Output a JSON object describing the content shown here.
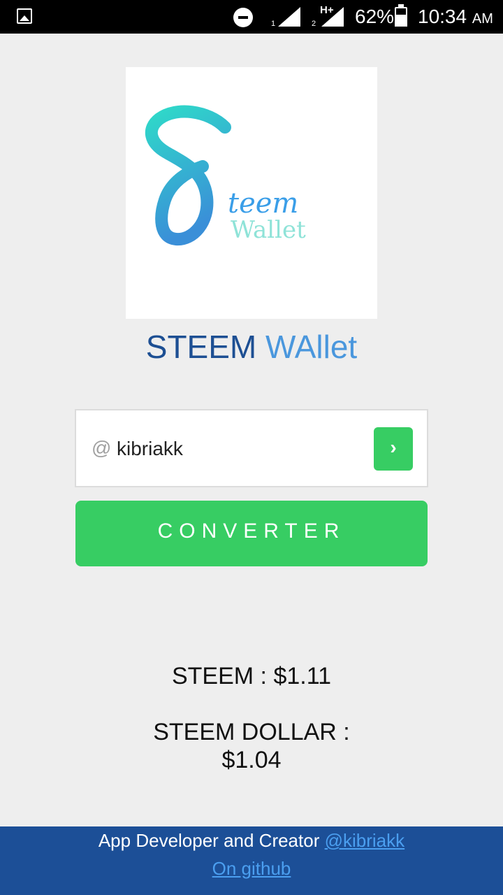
{
  "status_bar": {
    "sim1_label": "1",
    "sim2_label": "2",
    "network_type": "H+",
    "battery_percent": "62%",
    "battery_level": 0.62,
    "time": "10:34",
    "ampm": "AM",
    "icons": [
      "gallery-icon",
      "do-not-disturb-icon",
      "signal-icon",
      "battery-icon"
    ]
  },
  "logo": {
    "text_top": "teem",
    "text_bottom": "Wallet"
  },
  "title": {
    "part1": "STEEM",
    "part2": "WAllet"
  },
  "username": {
    "prefix": "@",
    "value": "kibriakk",
    "go_icon": "chevron-right-icon",
    "go_symbol": "›"
  },
  "converter_button": "CONVERTER",
  "prices": {
    "steem": "STEEM : $1.11",
    "sbd_label": "STEEM DOLLAR :",
    "sbd_value": "$1.04"
  },
  "footer": {
    "text": "App Developer and Creator",
    "author_link": "@kibriakk",
    "github_link": "On github"
  },
  "colors": {
    "accent_green": "#37cd63",
    "footer_blue": "#1c4f97",
    "title_dark": "#1d4f93",
    "title_light": "#4a97dd",
    "link_blue": "#4b9ff0"
  }
}
